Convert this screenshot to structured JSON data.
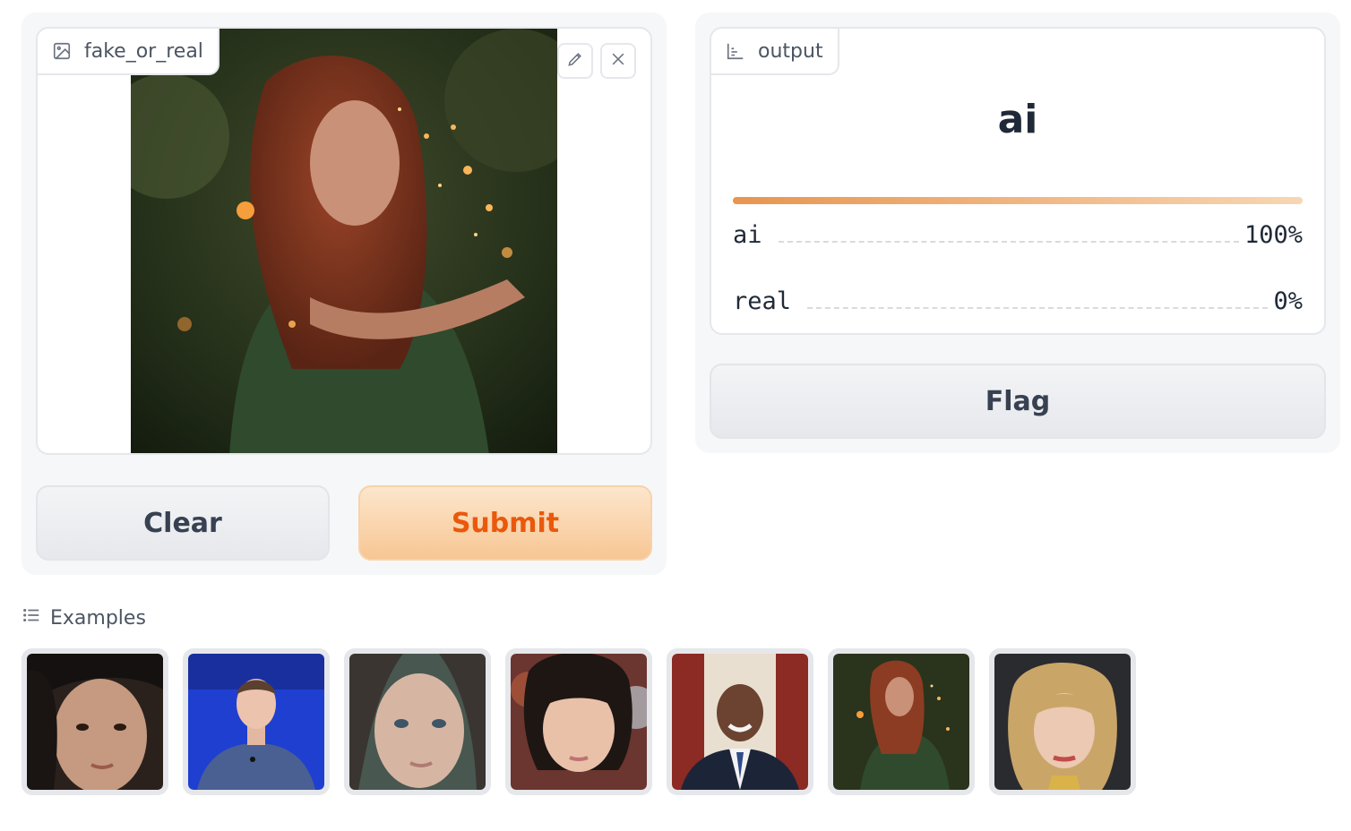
{
  "input": {
    "label": "fake_or_real",
    "label_icon": "image-icon",
    "edit_icon": "pencil-icon",
    "clear_icon": "close-icon"
  },
  "buttons": {
    "clear": "Clear",
    "submit": "Submit",
    "flag": "Flag"
  },
  "output": {
    "label": "output",
    "label_icon": "bar-chart-icon",
    "top_label": "ai",
    "confidences": [
      {
        "label": "ai",
        "value": "100%",
        "fraction": 1.0
      },
      {
        "label": "real",
        "value": "0%",
        "fraction": 0.0
      }
    ]
  },
  "examples": {
    "header": "Examples",
    "header_icon": "list-icon",
    "items": [
      "example-1",
      "example-2",
      "example-3",
      "example-4",
      "example-5",
      "example-6",
      "example-7"
    ]
  },
  "colors": {
    "accent": "#ea580c",
    "bar_start": "#e8954f",
    "bar_end": "#f8d6b3"
  }
}
